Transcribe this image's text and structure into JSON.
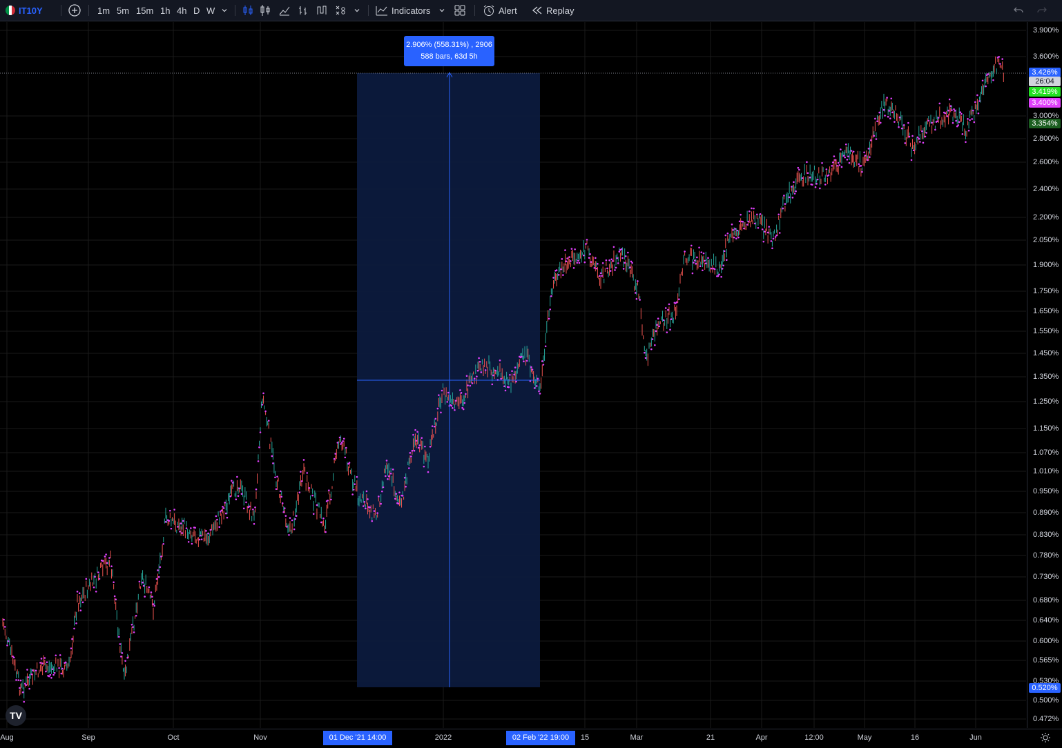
{
  "toolbar": {
    "symbol": "IT10Y",
    "timeframes": [
      "1m",
      "5m",
      "15m",
      "1h",
      "4h",
      "D",
      "W"
    ],
    "active_timeframe": "1h",
    "indicators_label": "Indicators",
    "alert_label": "Alert",
    "replay_label": "Replay"
  },
  "price_axis": {
    "labels": [
      "3.900%",
      "3.600%",
      "3.000%",
      "2.800%",
      "2.600%",
      "2.400%",
      "2.200%",
      "2.050%",
      "1.900%",
      "1.750%",
      "1.650%",
      "1.550%",
      "1.450%",
      "1.350%",
      "1.250%",
      "1.150%",
      "1.070%",
      "1.010%",
      "0.950%",
      "0.890%",
      "0.830%",
      "0.780%",
      "0.730%",
      "0.680%",
      "0.640%",
      "0.600%",
      "0.565%",
      "0.530%",
      "0.500%",
      "0.472%"
    ],
    "badges": [
      {
        "text": "3.426%",
        "bg": "#2962ff",
        "fg": "#ffffff"
      },
      {
        "text": "26:04",
        "bg": "#d1d4dc",
        "fg": "#131722"
      },
      {
        "text": "3.419%",
        "bg": "#22e022",
        "fg": "#ffffff"
      },
      {
        "text": "3.400%",
        "bg": "#e040fb",
        "fg": "#ffffff"
      },
      {
        "text": "3.354%",
        "bg": "#1b5e20",
        "fg": "#ffffff"
      },
      {
        "text": "0.520%",
        "bg": "#2962ff",
        "fg": "#ffffff"
      }
    ]
  },
  "time_axis": {
    "labels": [
      "Aug",
      "Sep",
      "Oct",
      "Nov",
      "2022",
      "15",
      "Mar",
      "21",
      "Apr",
      "12:00",
      "May",
      "16",
      "Jun"
    ],
    "range_start": "01 Dec '21  14:00",
    "range_end": "02 Feb '22  19:00"
  },
  "measure_tooltip": {
    "line1": "2.906% (558.31%) , 2906",
    "line2": "588 bars, 63d 5h"
  },
  "logo_text": "TV",
  "colors": {
    "background": "#000000",
    "up": "#26a69a",
    "down": "#ef5350",
    "overlay": "#e040fb",
    "accent": "#2962ff",
    "selection": "#0c1a3d"
  }
}
